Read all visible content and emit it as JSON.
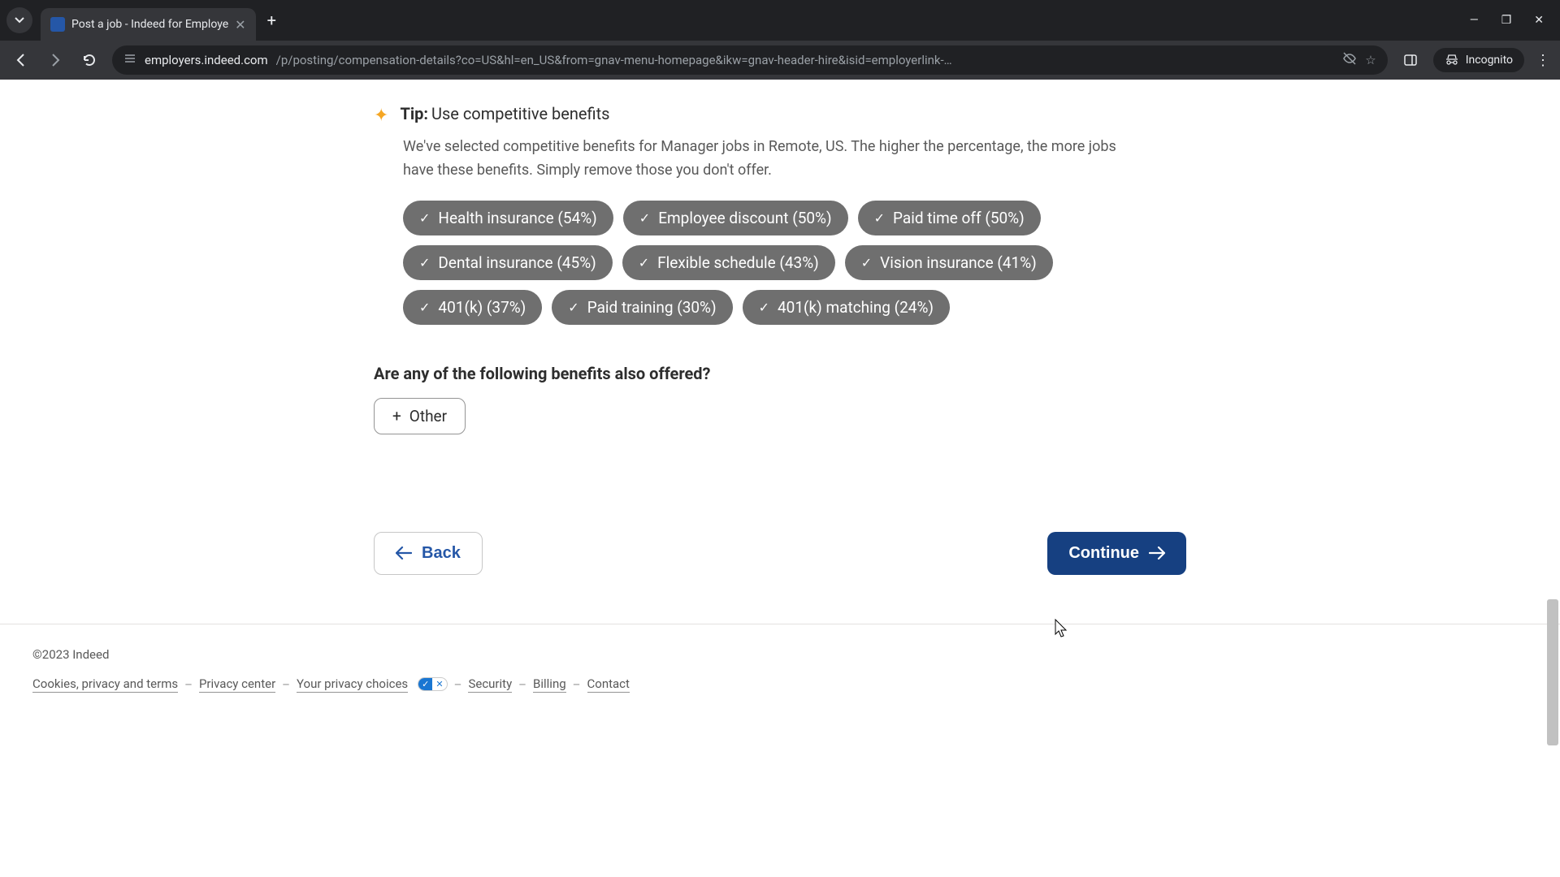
{
  "browser": {
    "tab_title": "Post a job - Indeed for Employe",
    "url_host": "employers.indeed.com",
    "url_path": "/p/posting/compensation-details?co=US&hl=en_US&from=gnav-menu-homepage&ikw=gnav-header-hire&isid=employerlink-…",
    "incognito_label": "Incognito"
  },
  "tip": {
    "label": "Tip:",
    "text": "Use competitive benefits",
    "description": "We've selected competitive benefits for Manager jobs in Remote, US. The higher the percentage, the more jobs have these benefits. Simply remove those you don't offer."
  },
  "benefits": [
    {
      "label": "Health insurance (54%)"
    },
    {
      "label": "Employee discount (50%)"
    },
    {
      "label": "Paid time off (50%)"
    },
    {
      "label": "Dental insurance (45%)"
    },
    {
      "label": "Flexible schedule (43%)"
    },
    {
      "label": "Vision insurance (41%)"
    },
    {
      "label": "401(k) (37%)"
    },
    {
      "label": "Paid training (30%)"
    },
    {
      "label": "401(k) matching (24%)"
    }
  ],
  "additional": {
    "heading": "Are any of the following benefits also offered?",
    "other_label": "Other"
  },
  "nav": {
    "back": "Back",
    "continue": "Continue"
  },
  "footer": {
    "copyright": "©2023 Indeed",
    "links": {
      "cookies": "Cookies, privacy and terms",
      "privacy_center": "Privacy center",
      "your_choices": "Your privacy choices",
      "security": "Security",
      "billing": "Billing",
      "contact": "Contact"
    }
  }
}
